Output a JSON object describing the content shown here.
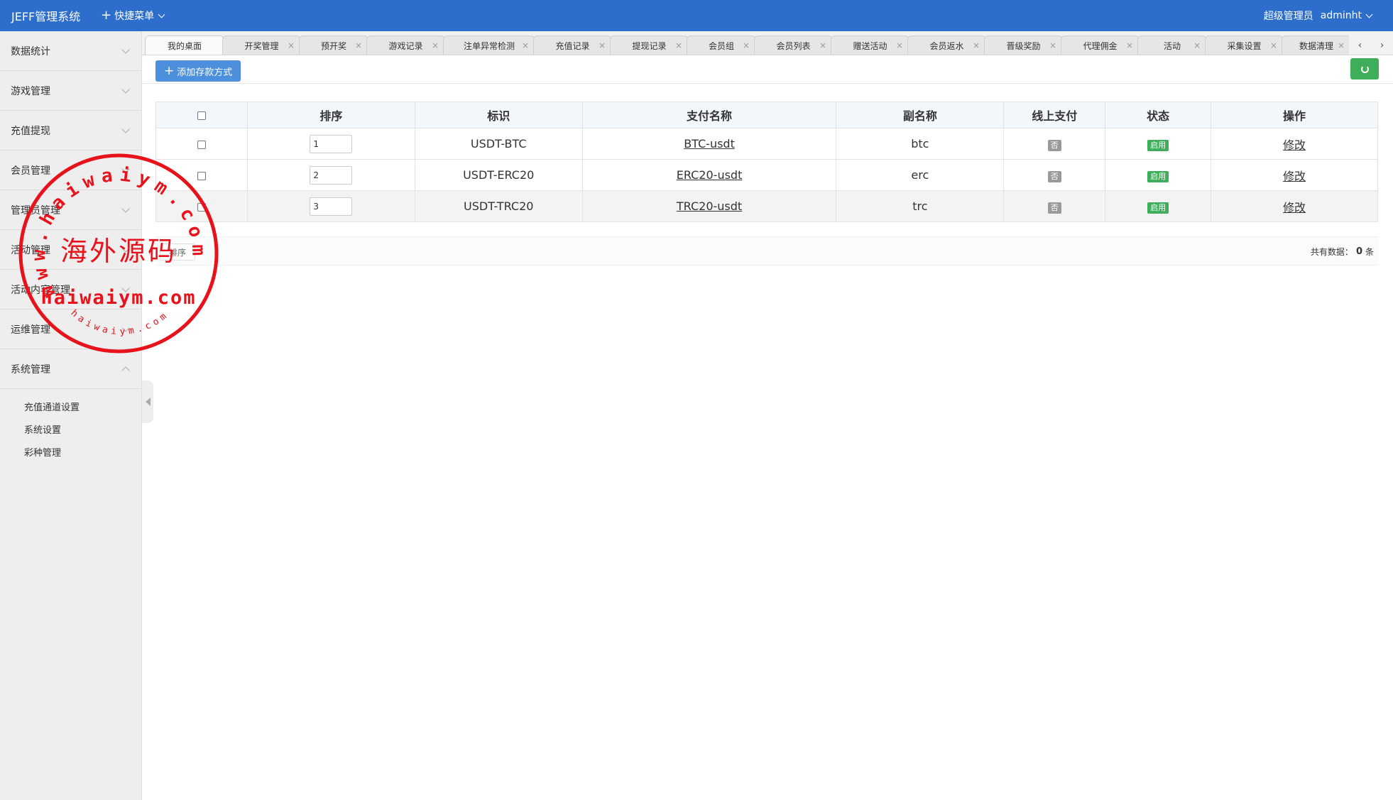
{
  "header": {
    "brand": "JEFF管理系统",
    "quick_menu": "快捷菜单",
    "role": "超级管理员",
    "username": "adminht"
  },
  "sidebar": {
    "items": [
      {
        "label": "数据统计"
      },
      {
        "label": "游戏管理"
      },
      {
        "label": "充值提现"
      },
      {
        "label": "会员管理"
      },
      {
        "label": "管理员管理"
      },
      {
        "label": "活动管理"
      },
      {
        "label": "活动内容管理"
      },
      {
        "label": "运维管理"
      },
      {
        "label": "系统管理"
      }
    ],
    "submenu": [
      {
        "label": "充值通道设置"
      },
      {
        "label": "系统设置"
      },
      {
        "label": "彩种管理"
      }
    ]
  },
  "tabs": [
    {
      "label": "我的桌面"
    },
    {
      "label": "开奖管理"
    },
    {
      "label": "预开奖"
    },
    {
      "label": "游戏记录"
    },
    {
      "label": "注单异常检测"
    },
    {
      "label": "充值记录"
    },
    {
      "label": "提现记录"
    },
    {
      "label": "会员组"
    },
    {
      "label": "会员列表"
    },
    {
      "label": "赠送活动"
    },
    {
      "label": "会员返水"
    },
    {
      "label": "晋级奖励"
    },
    {
      "label": "代理佣金"
    },
    {
      "label": "活动"
    },
    {
      "label": "采集设置"
    },
    {
      "label": "数据清理"
    }
  ],
  "tab_close_glyph": "×",
  "tab_nav": {
    "prev": "‹",
    "next": "›"
  },
  "toolbar": {
    "add_label": "添加存款方式"
  },
  "table": {
    "columns": {
      "sort": "排序",
      "code": "标识",
      "pay_name": "支付名称",
      "sub_name": "副名称",
      "online": "线上支付",
      "status": "状态",
      "action": "操作"
    },
    "rows": [
      {
        "sort": "1",
        "code": "USDT-BTC",
        "pay_name": "BTC-usdt",
        "sub_name": "btc",
        "online": "否",
        "status": "启用",
        "action": "修改"
      },
      {
        "sort": "2",
        "code": "USDT-ERC20",
        "pay_name": "ERC20-usdt",
        "sub_name": "erc",
        "online": "否",
        "status": "启用",
        "action": "修改"
      },
      {
        "sort": "3",
        "code": "USDT-TRC20",
        "pay_name": "TRC20-usdt",
        "sub_name": "trc",
        "online": "否",
        "status": "启用",
        "action": "修改"
      }
    ]
  },
  "footer": {
    "sort_button": "排序",
    "total_prefix": "共有数据：",
    "total_count": "0",
    "total_suffix": "条"
  },
  "watermark": {
    "center_text": "海外源码",
    "domain_text": "haiwaiym.com",
    "ring_text": "www.haiwaiym.com",
    "bottom_text": "haiwaiym.com"
  },
  "colors": {
    "header_bg": "#2d6dcc",
    "add_button": "#4c8fdc",
    "refresh_button": "#3fae5b",
    "badge_off": "#9a9a9a",
    "badge_on": "#3fae5b",
    "stamp_red": "#e8121b"
  }
}
